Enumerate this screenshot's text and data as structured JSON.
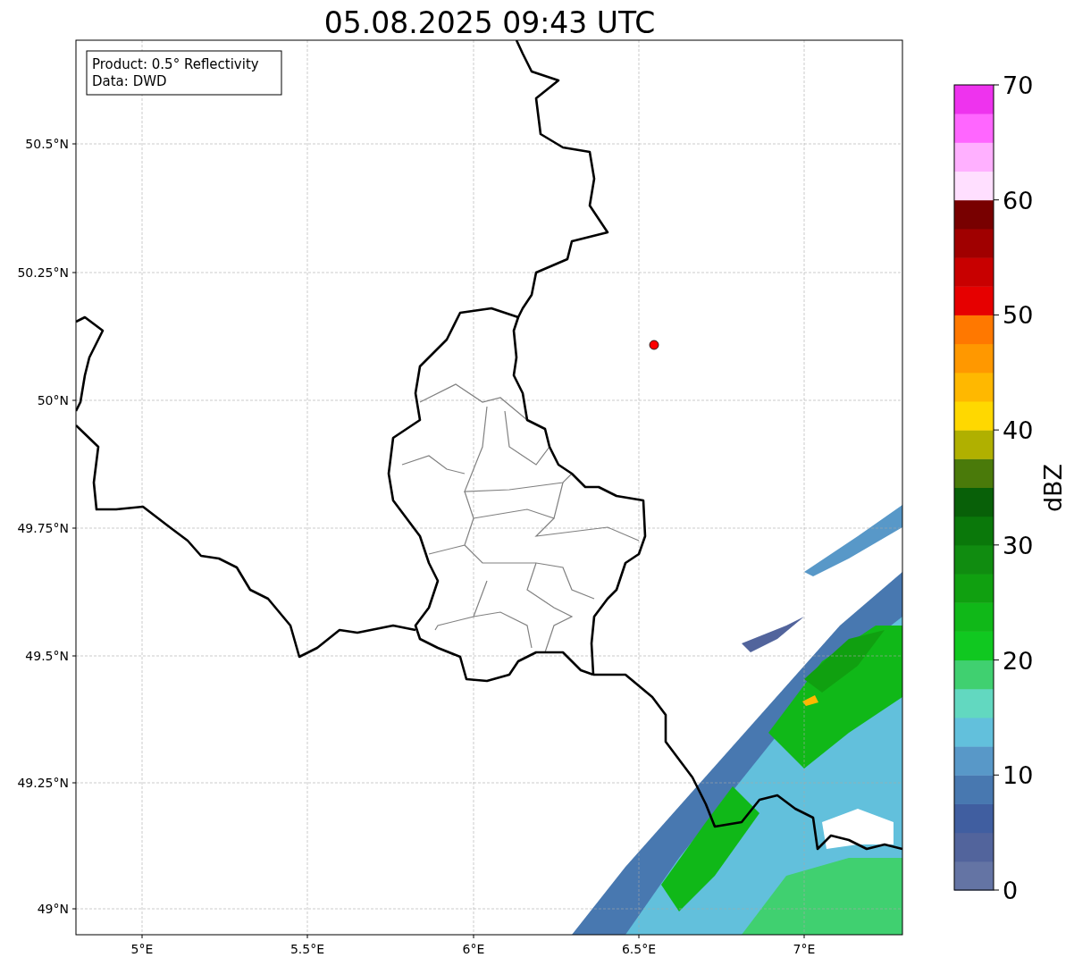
{
  "title": "05.08.2025 09:43 UTC",
  "info_box": [
    "Product: 0.5° Reflectivity",
    "Data: DWD"
  ],
  "x_ticks": [
    "5°E",
    "5.5°E",
    "6°E",
    "6.5°E",
    "7°E"
  ],
  "y_ticks": [
    "50.5°N",
    "50.25°N",
    "50°N",
    "49.75°N",
    "49.5°N",
    "49.25°N",
    "49°N"
  ],
  "colorbar": {
    "label": "dBZ",
    "ticks": [
      "70",
      "60",
      "50",
      "40",
      "30",
      "20",
      "10",
      "0"
    ],
    "segments": [
      {
        "color": "#6474a4"
      },
      {
        "color": "#52649c"
      },
      {
        "color": "#405ea0"
      },
      {
        "color": "#4878b0"
      },
      {
        "color": "#5898c8"
      },
      {
        "color": "#62c0dc"
      },
      {
        "color": "#62d8c0"
      },
      {
        "color": "#40d070"
      },
      {
        "color": "#10c820"
      },
      {
        "color": "#10b818"
      },
      {
        "color": "#10a010"
      },
      {
        "color": "#108c10"
      },
      {
        "color": "#0a780a"
      },
      {
        "color": "#086008"
      },
      {
        "color": "#4a7a0a"
      },
      {
        "color": "#b0b000"
      },
      {
        "color": "#ffd800"
      },
      {
        "color": "#ffb800"
      },
      {
        "color": "#ff9800"
      },
      {
        "color": "#ff7800"
      },
      {
        "color": "#e60000"
      },
      {
        "color": "#c80000"
      },
      {
        "color": "#a00000"
      },
      {
        "color": "#780000"
      },
      {
        "color": "#ffdfff"
      },
      {
        "color": "#ffb0ff"
      },
      {
        "color": "#ff66ff"
      },
      {
        "color": "#ee33ee"
      }
    ]
  }
}
